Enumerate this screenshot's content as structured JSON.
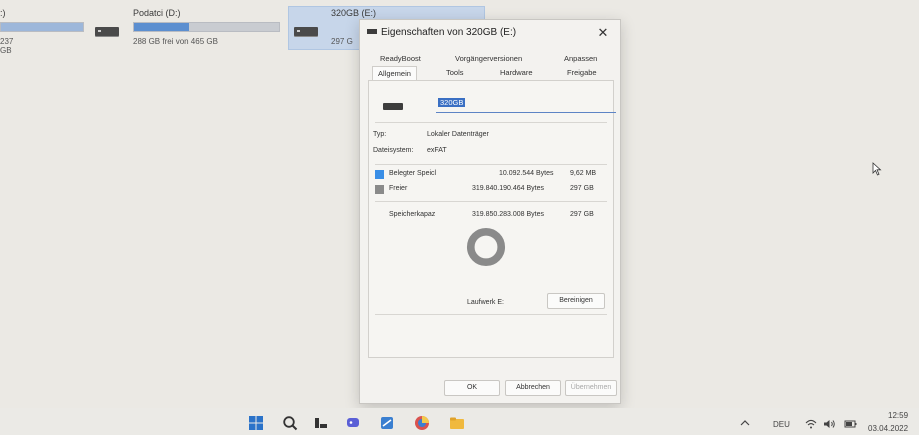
{
  "explorer": {
    "drives": [
      {
        "label": ":)",
        "free_text": "237 GB"
      },
      {
        "label": "Podatci (D:)",
        "free_text": "288 GB frei von 465 GB",
        "fill": 0.38
      },
      {
        "label": "320GB (E:)",
        "free_text": "297 G"
      }
    ]
  },
  "dialog": {
    "title": "Eigenschaften von 320GB (E:)",
    "close_glyph": "✕",
    "tabs_row1": [
      "ReadyBoost",
      "Vorgängerversionen",
      "Anpassen"
    ],
    "tabs_row2": [
      "Allgemein",
      "Tools",
      "Hardware",
      "Freigabe"
    ],
    "active_tab": "Allgemein",
    "drive_name": "320GB",
    "type_label": "Typ:",
    "type_value": "Lokaler Datenträger",
    "fs_label": "Dateisystem:",
    "fs_value": "exFAT",
    "used_label": "Belegter Speicl",
    "used_bytes": "10.092.544 Bytes",
    "used_size": "9,62 MB",
    "free_label": "Freier",
    "free_bytes": "319.840.190.464 Bytes",
    "free_size": "297 GB",
    "capacity_label": "Speicherkapaz",
    "capacity_bytes": "319.850.283.008 Bytes",
    "capacity_size": "297 GB",
    "drive_letter_label": "Laufwerk E:",
    "cleanup_button": "Bereinigen",
    "ok_button": "OK",
    "cancel_button": "Abbrechen",
    "apply_button": "Übernehmen",
    "used_color": "#3a8ee6",
    "free_color": "#8a8a8a",
    "used_fraction": 3e-05
  },
  "taskbar": {
    "language": "DEU",
    "time": "12:59",
    "date": "03.04.2022"
  }
}
